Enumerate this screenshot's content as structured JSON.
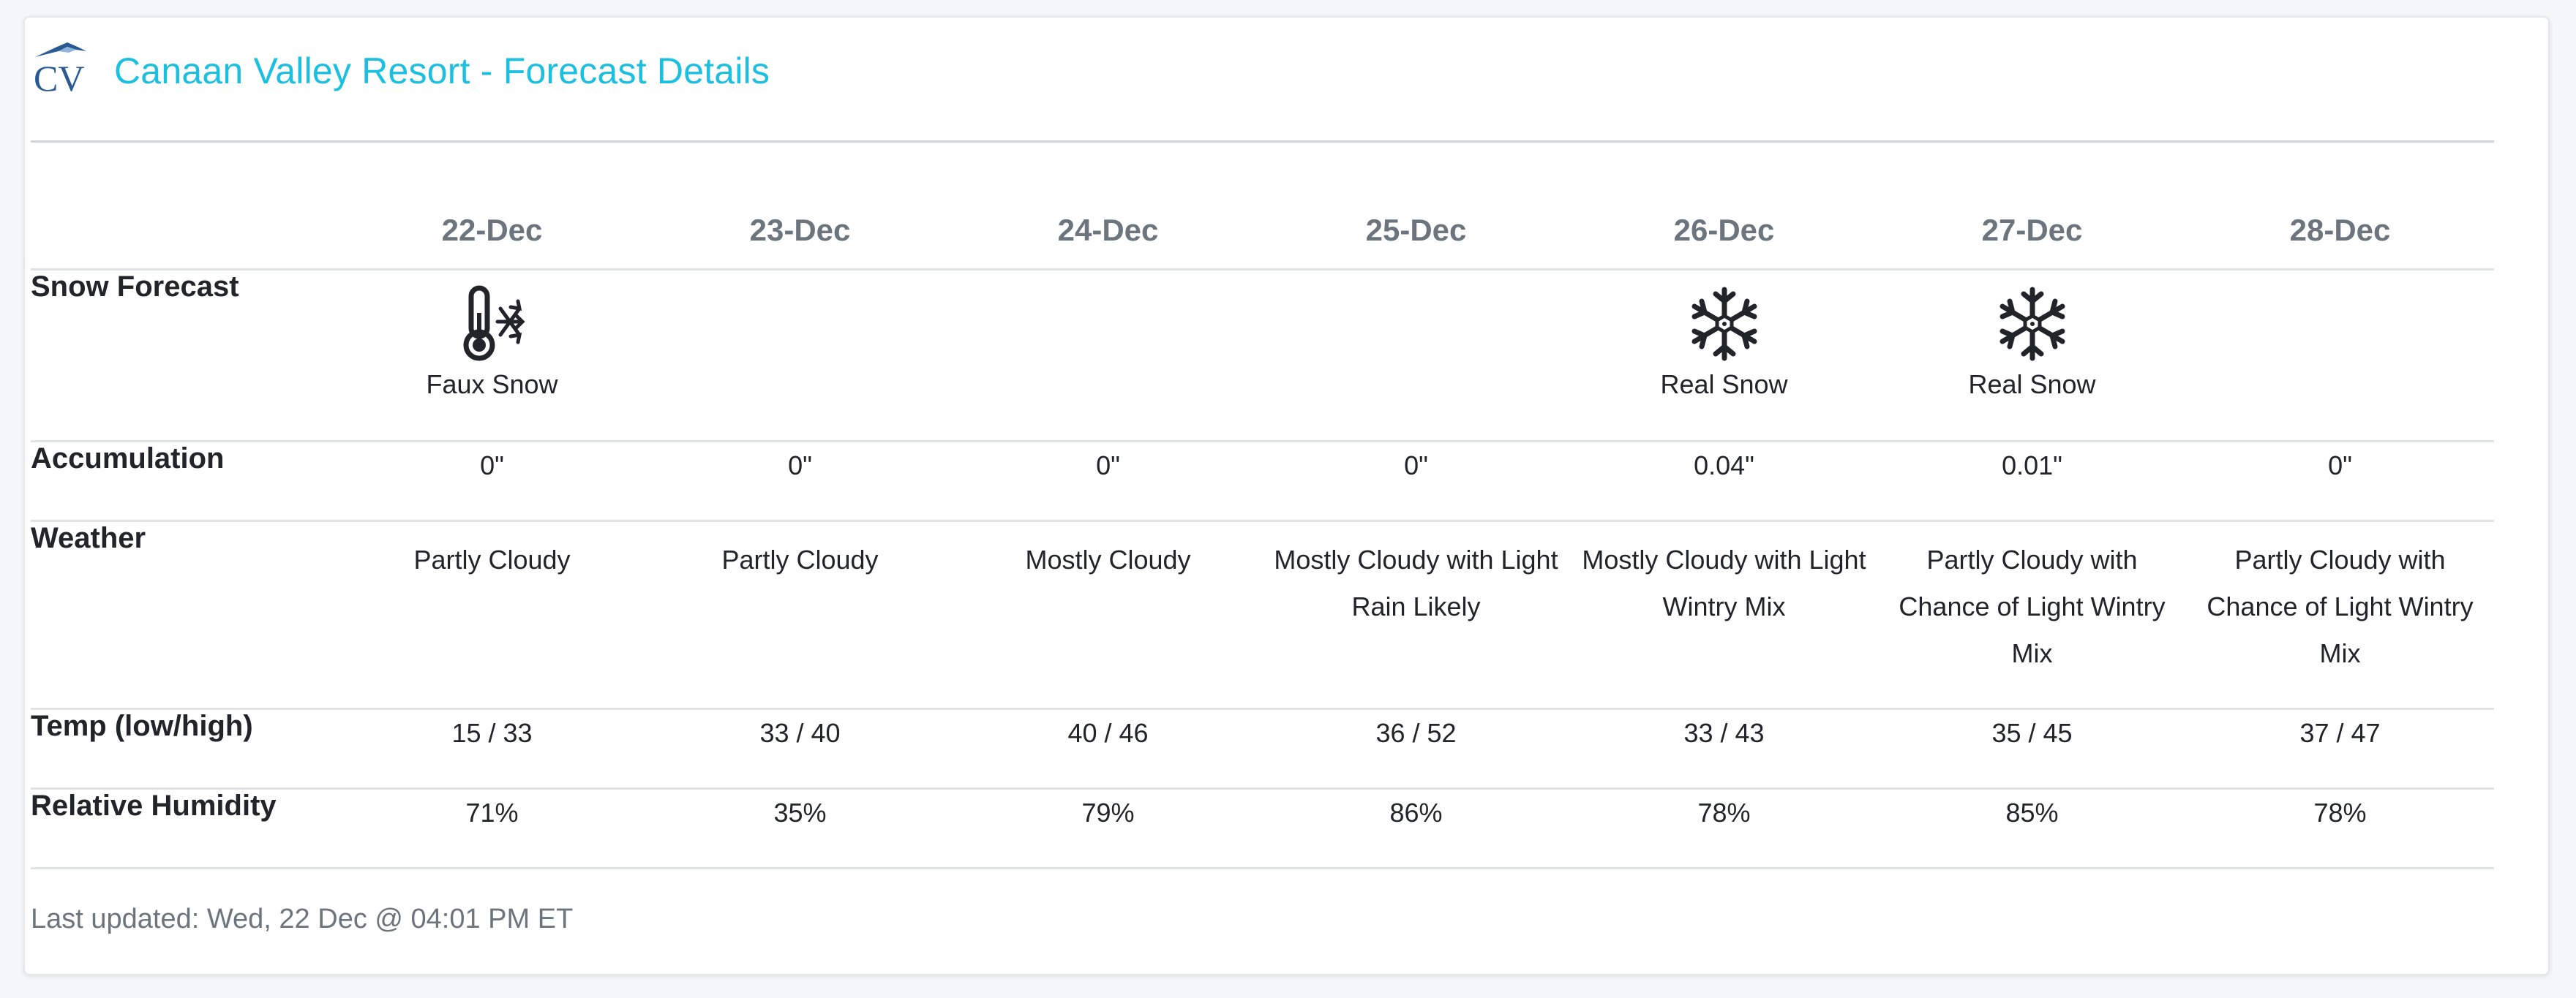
{
  "header": {
    "title": "Canaan Valley Resort - Forecast Details",
    "logo_text": "CV",
    "logo_color": "#2a5a94",
    "title_color": "#1bbfe0"
  },
  "table": {
    "days": [
      "22-Dec",
      "23-Dec",
      "24-Dec",
      "25-Dec",
      "26-Dec",
      "27-Dec",
      "28-Dec"
    ],
    "rows": {
      "snow": {
        "label": "Snow Forecast",
        "values": [
          {
            "icon": "thermometer-snowflake-icon",
            "text": "Faux Snow"
          },
          {
            "icon": "",
            "text": ""
          },
          {
            "icon": "",
            "text": ""
          },
          {
            "icon": "",
            "text": ""
          },
          {
            "icon": "snowflake-icon",
            "text": "Real Snow"
          },
          {
            "icon": "snowflake-icon",
            "text": "Real Snow"
          },
          {
            "icon": "",
            "text": ""
          }
        ]
      },
      "accumulation": {
        "label": "Accumulation",
        "values": [
          "0\"",
          "0\"",
          "0\"",
          "0\"",
          "0.04\"",
          "0.01\"",
          "0\""
        ]
      },
      "weather": {
        "label": "Weather",
        "values": [
          "Partly Cloudy",
          "Partly Cloudy",
          "Mostly Cloudy",
          "Mostly Cloudy with Light Rain Likely",
          "Mostly Cloudy with Light Wintry Mix",
          "Partly Cloudy with Chance of Light Wintry Mix",
          "Partly Cloudy with Chance of Light Wintry Mix"
        ]
      },
      "temp": {
        "label": "Temp (low/high)",
        "values": [
          "15 / 33",
          "33 / 40",
          "40 / 46",
          "36 / 52",
          "33 / 43",
          "35 / 45",
          "37 / 47"
        ]
      },
      "humidity": {
        "label": "Relative Humidity",
        "values": [
          "71%",
          "35%",
          "79%",
          "86%",
          "78%",
          "85%",
          "78%"
        ]
      }
    }
  },
  "footer": {
    "last_updated": "Last updated: Wed, 22 Dec @ 04:01 PM ET"
  }
}
